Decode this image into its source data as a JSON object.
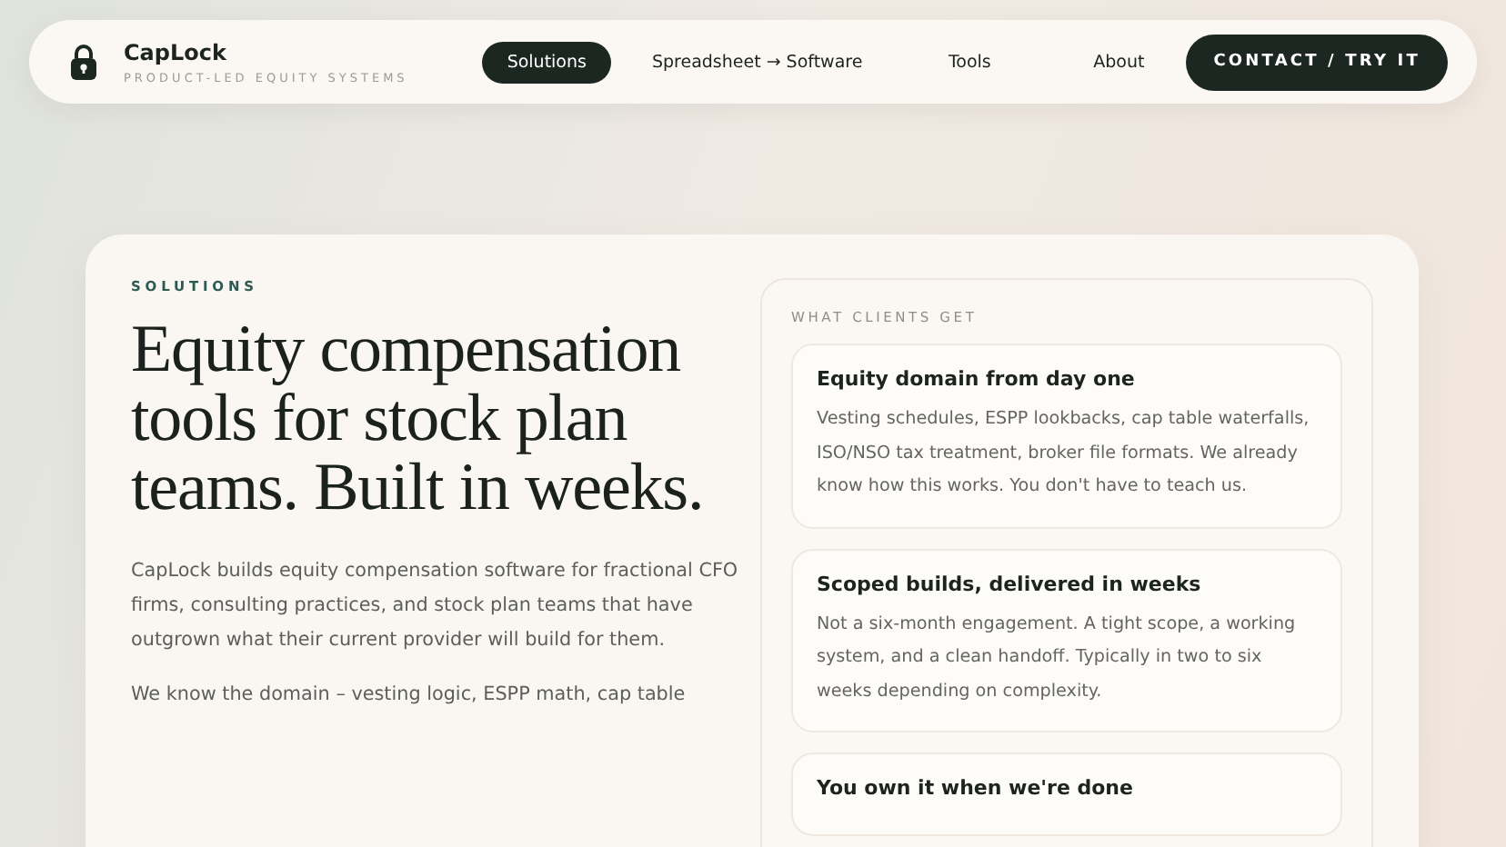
{
  "nav": {
    "brand": "CapLock",
    "tagline": "PRODUCT-LED EQUITY SYSTEMS",
    "links": [
      {
        "label": "Solutions",
        "selected": true
      },
      {
        "label": "Spreadsheet → Software",
        "selected": false
      },
      {
        "label": "Tools",
        "selected": false
      },
      {
        "label": "About",
        "selected": false
      }
    ],
    "cta": "CONTACT / TRY IT"
  },
  "hero": {
    "eyebrow": "SOLUTIONS",
    "heading": "Equity compensation tools for stock plan teams. Built in weeks.",
    "paragraphs": [
      "CapLock builds equity compensation software for fractional CFO firms, consulting practices, and stock plan teams that have outgrown what their current provider will build for them.",
      "We know the domain – vesting logic, ESPP math, cap table"
    ]
  },
  "benefits": {
    "title": "WHAT CLIENTS GET",
    "items": [
      {
        "title": "Equity domain from day one",
        "body": "Vesting schedules, ESPP lookbacks, cap table waterfalls, ISO/NSO tax treatment, broker file formats. We already know how this works. You don't have to teach us."
      },
      {
        "title": "Scoped builds, delivered in weeks",
        "body": "Not a six-month engagement. A tight scope, a working system, and a clean handoff. Typically in two to six weeks depending on complexity."
      },
      {
        "title": "You own it when we're done"
      }
    ]
  }
}
